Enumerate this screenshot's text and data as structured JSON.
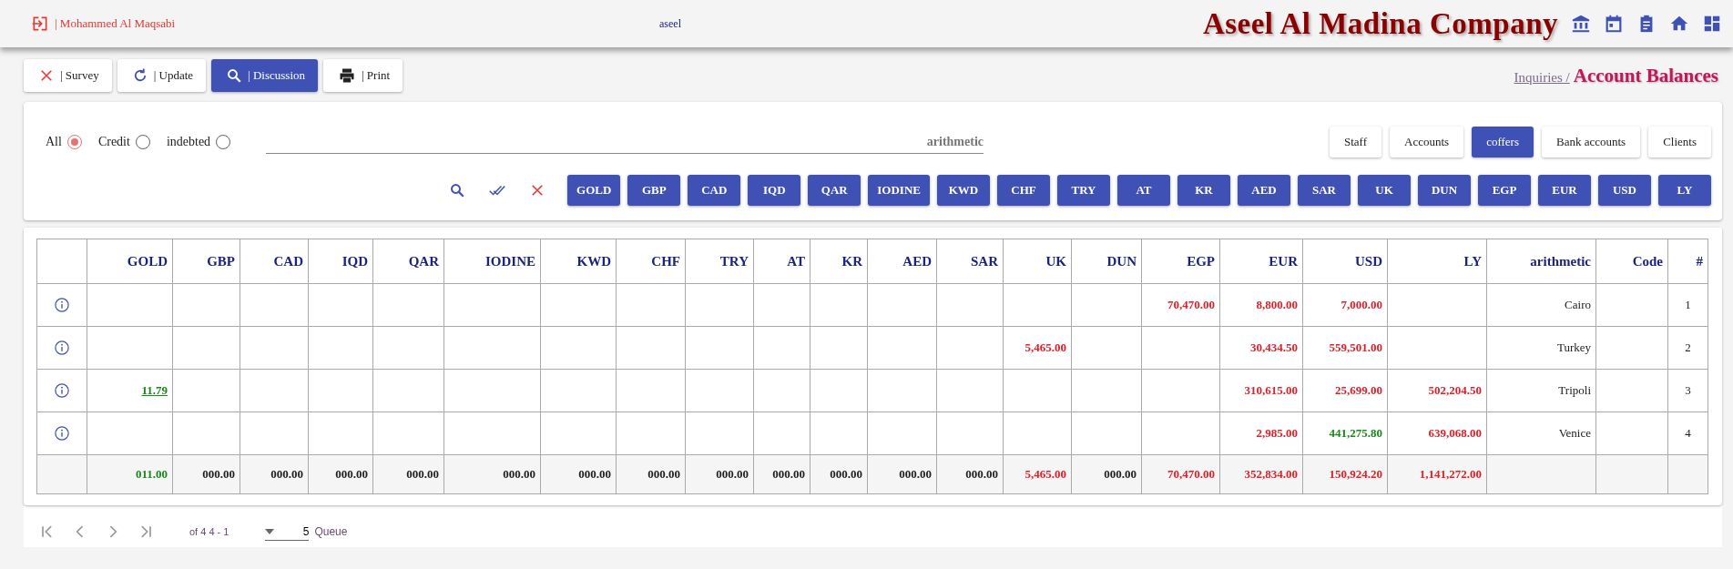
{
  "header": {
    "user": "| Mohammed Al Maqsabi",
    "center_label": "aseel",
    "company": "Aseel Al Madina Company",
    "nav_icons": [
      {
        "kind": "bank"
      },
      {
        "kind": "calendar"
      },
      {
        "kind": "clipboard"
      },
      {
        "kind": "home"
      },
      {
        "kind": "dashboard"
      }
    ]
  },
  "toolbar": [
    {
      "label": "| Survey",
      "kind": "clear",
      "selected": false
    },
    {
      "label": "| Update",
      "kind": "refresh",
      "selected": false
    },
    {
      "label": "| Discussion",
      "kind": "search",
      "selected": true
    },
    {
      "label": "| Print",
      "kind": "print",
      "selected": false
    }
  ],
  "breadcrumb": {
    "parent": "Inquiries /",
    "current": "Account Balances"
  },
  "filters": {
    "radios": [
      {
        "label": "All",
        "selected": true
      },
      {
        "label": "Credit",
        "selected": false
      },
      {
        "label": "indebted",
        "selected": false
      }
    ],
    "search": {
      "placeholder": "arithmetic"
    },
    "tabs": [
      {
        "label": "Staff",
        "selected": false
      },
      {
        "label": "Accounts",
        "selected": false
      },
      {
        "label": "coffers",
        "selected": true
      },
      {
        "label": "Bank accounts",
        "selected": false
      },
      {
        "label": "Clients",
        "selected": false
      }
    ],
    "actions": [
      {
        "kind": "search"
      },
      {
        "kind": "check-all"
      },
      {
        "kind": "clear"
      }
    ],
    "currency_buttons": [
      "GOLD",
      "GBP",
      "CAD",
      "IQD",
      "QAR",
      "IODINE",
      "KWD",
      "CHF",
      "TRY",
      "AT",
      "KR",
      "AED",
      "SAR",
      "UK",
      "DUN",
      "EGP",
      "EUR",
      "USD",
      "LY"
    ]
  },
  "table": {
    "currency_columns": [
      "GOLD",
      "GBP",
      "CAD",
      "IQD",
      "QAR",
      "IODINE",
      "KWD",
      "CHF",
      "TRY",
      "AT",
      "KR",
      "AED",
      "SAR",
      "UK",
      "DUN",
      "EGP",
      "EUR",
      "USD",
      "LY"
    ],
    "name_column": "arithmetic",
    "code_column": "Code",
    "number_column": "#",
    "rows": [
      {
        "amounts": [
          {
            "kind": "empty"
          },
          {
            "kind": "empty"
          },
          {
            "kind": "empty"
          },
          {
            "kind": "empty"
          },
          {
            "kind": "empty"
          },
          {
            "kind": "empty"
          },
          {
            "kind": "empty"
          },
          {
            "kind": "empty"
          },
          {
            "kind": "empty"
          },
          {
            "kind": "empty"
          },
          {
            "kind": "empty"
          },
          {
            "kind": "empty"
          },
          {
            "kind": "empty"
          },
          {
            "kind": "empty"
          },
          {
            "kind": "empty"
          },
          {
            "kind": "amount",
            "text": "70,470.00",
            "color": "#e0202a"
          },
          {
            "kind": "amount",
            "text": "8,800.00",
            "color": "#e0202a"
          },
          {
            "kind": "amount",
            "text": "7,000.00",
            "color": "#e0202a"
          },
          {
            "kind": "empty"
          }
        ],
        "name": "Cairo",
        "number": "1"
      },
      {
        "amounts": [
          {
            "kind": "empty"
          },
          {
            "kind": "empty"
          },
          {
            "kind": "empty"
          },
          {
            "kind": "empty"
          },
          {
            "kind": "empty"
          },
          {
            "kind": "empty"
          },
          {
            "kind": "empty"
          },
          {
            "kind": "empty"
          },
          {
            "kind": "empty"
          },
          {
            "kind": "empty"
          },
          {
            "kind": "empty"
          },
          {
            "kind": "empty"
          },
          {
            "kind": "empty"
          },
          {
            "kind": "amount",
            "text": "5,465.00",
            "color": "#e0202a"
          },
          {
            "kind": "empty"
          },
          {
            "kind": "empty"
          },
          {
            "kind": "amount",
            "text": "30,434.50",
            "color": "#e0202a"
          },
          {
            "kind": "amount",
            "text": "559,501.00",
            "color": "#e0202a"
          },
          {
            "kind": "empty"
          }
        ],
        "name": "Turkey",
        "number": "2"
      },
      {
        "amounts": [
          {
            "kind": "link",
            "text": "11.79",
            "color": "#1a8a1a"
          },
          {
            "kind": "empty"
          },
          {
            "kind": "empty"
          },
          {
            "kind": "empty"
          },
          {
            "kind": "empty"
          },
          {
            "kind": "empty"
          },
          {
            "kind": "empty"
          },
          {
            "kind": "empty"
          },
          {
            "kind": "empty"
          },
          {
            "kind": "empty"
          },
          {
            "kind": "empty"
          },
          {
            "kind": "empty"
          },
          {
            "kind": "empty"
          },
          {
            "kind": "empty"
          },
          {
            "kind": "empty"
          },
          {
            "kind": "empty"
          },
          {
            "kind": "amount",
            "text": "310,615.00",
            "color": "#e0202a"
          },
          {
            "kind": "amount",
            "text": "25,699.00",
            "color": "#e0202a"
          },
          {
            "kind": "amount",
            "text": "502,204.50",
            "color": "#e0202a"
          }
        ],
        "name": "Tripoli",
        "number": "3"
      },
      {
        "amounts": [
          {
            "kind": "empty"
          },
          {
            "kind": "empty"
          },
          {
            "kind": "empty"
          },
          {
            "kind": "empty"
          },
          {
            "kind": "empty"
          },
          {
            "kind": "empty"
          },
          {
            "kind": "empty"
          },
          {
            "kind": "empty"
          },
          {
            "kind": "empty"
          },
          {
            "kind": "empty"
          },
          {
            "kind": "empty"
          },
          {
            "kind": "empty"
          },
          {
            "kind": "empty"
          },
          {
            "kind": "empty"
          },
          {
            "kind": "empty"
          },
          {
            "kind": "empty"
          },
          {
            "kind": "amount",
            "text": "2,985.00",
            "color": "#e0202a"
          },
          {
            "kind": "amount",
            "text": "441,275.80",
            "color": "#1a8a1a"
          },
          {
            "kind": "amount",
            "text": "639,068.00",
            "color": "#e0202a"
          }
        ],
        "name": "Venice",
        "number": "4"
      }
    ],
    "totals": [
      {
        "text": "011.00",
        "color": "#1a8a1a"
      },
      {
        "text": "000.00",
        "color": "#222222"
      },
      {
        "text": "000.00",
        "color": "#222222"
      },
      {
        "text": "000.00",
        "color": "#222222"
      },
      {
        "text": "000.00",
        "color": "#222222"
      },
      {
        "text": "000.00",
        "color": "#222222"
      },
      {
        "text": "000.00",
        "color": "#222222"
      },
      {
        "text": "000.00",
        "color": "#222222"
      },
      {
        "text": "000.00",
        "color": "#222222"
      },
      {
        "text": "000.00",
        "color": "#222222"
      },
      {
        "text": "000.00",
        "color": "#222222"
      },
      {
        "text": "000.00",
        "color": "#222222"
      },
      {
        "text": "000.00",
        "color": "#222222"
      },
      {
        "text": "5,465.00",
        "color": "#e0202a"
      },
      {
        "text": "000.00",
        "color": "#222222"
      },
      {
        "text": "70,470.00",
        "color": "#e0202a"
      },
      {
        "text": "352,834.00",
        "color": "#e0202a"
      },
      {
        "text": "150,924.20",
        "color": "#e0202a"
      },
      {
        "text": "1,141,272.00",
        "color": "#e0202a"
      }
    ]
  },
  "pagination": {
    "range": "of 4 4 - 1",
    "page_size": "5",
    "page_size_label": "Queue"
  }
}
